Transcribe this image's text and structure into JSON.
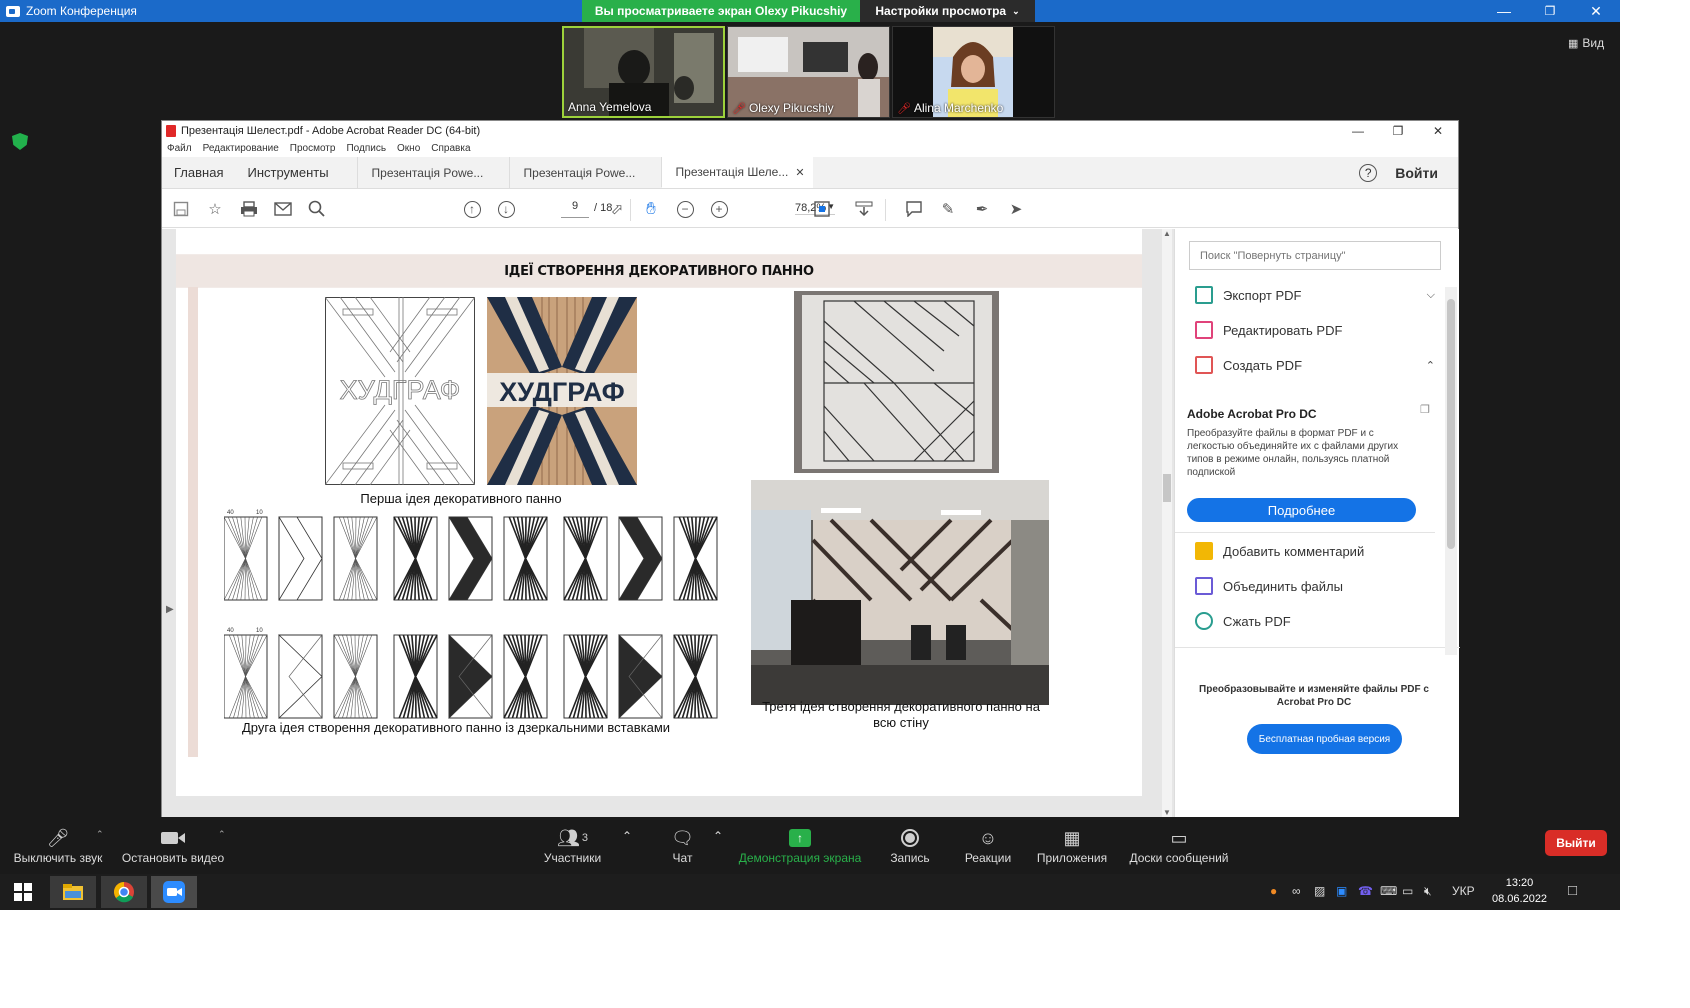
{
  "zoom": {
    "window_title": "Zoom Конференция",
    "share_banner": "Вы просматриваете экран Olexy Pikucshiy",
    "view_settings": "Настройки просмотра",
    "view_label": "Вид",
    "participants": [
      {
        "name": "Anna Yemelova",
        "muted": false
      },
      {
        "name": "Olexy Pikucshiy",
        "muted": true
      },
      {
        "name": "Alina Marchenko",
        "muted": true
      }
    ],
    "controls": {
      "mute": "Выключить звук",
      "stop_video": "Остановить видео",
      "participants": "Участники",
      "participants_count": "3",
      "chat": "Чат",
      "share": "Демонстрация экрана",
      "record": "Запись",
      "reactions": "Реакции",
      "apps": "Приложения",
      "whiteboards": "Доски сообщений",
      "leave": "Выйти"
    },
    "accent_green": "#29b04a",
    "title_blue": "#1b6ac9"
  },
  "acrobat": {
    "window_title": "Презентація Шелест.pdf - Adobe Acrobat Reader DC (64-bit)",
    "menu": [
      "Файл",
      "Редактирование",
      "Просмотр",
      "Подпись",
      "Окно",
      "Справка"
    ],
    "nav": {
      "home": "Главная",
      "tools": "Инструменты"
    },
    "tabs": [
      "Презентація Powe...",
      "Презентація Powe...",
      "Презентація Шеле..."
    ],
    "signin": "Войти",
    "page_current": "9",
    "page_total": "/ 18",
    "zoom_level": "78,2%",
    "document": {
      "heading": "ІДЕЇ СТВОРЕННЯ ДЕКОРАТИВНОГО ПАННО",
      "logo_text": "ХУДГРАФ",
      "caption_first": "Перша ідея декоративного панно",
      "caption_second": "Друга ідея створення декоративного панно із дзеркальними вставками",
      "caption_third": "Третя ідея створення декоративного панно на всю стіну",
      "dim_a": "40",
      "dim_b": "10"
    },
    "right_pane": {
      "search_placeholder": "Поиск \"Повернуть страницу\"",
      "tools_top": [
        {
          "label": "Экспорт PDF",
          "icon": "export-pdf-icon",
          "color": "#2a9d8f"
        },
        {
          "label": "Редактировать PDF",
          "icon": "edit-pdf-icon",
          "color": "#e0437a"
        },
        {
          "label": "Создать PDF",
          "icon": "create-pdf-icon",
          "color": "#e05555"
        }
      ],
      "pro_title": "Adobe Acrobat Pro DC",
      "pro_desc": "Преобразуйте файлы в формат PDF и с легкостью объединяйте их с файлами других типов в режиме онлайн, пользуясь платной подпиской",
      "pro_button": "Подробнее",
      "tools_bottom": [
        {
          "label": "Добавить комментарий",
          "icon": "comment-icon",
          "color": "#f2b705"
        },
        {
          "label": "Объединить файлы",
          "icon": "combine-files-icon",
          "color": "#6b5bd6"
        },
        {
          "label": "Сжать PDF",
          "icon": "compress-pdf-icon",
          "color": "#2a9d8f"
        }
      ],
      "promo_text": "Преобразовывайте и изменяйте файлы PDF с Acrobat Pro DC",
      "promo_button": "Бесплатная пробная версия",
      "accent_blue": "#1473e6"
    }
  },
  "taskbar": {
    "language": "УКР",
    "time": "13:20",
    "date": "08.06.2022"
  }
}
